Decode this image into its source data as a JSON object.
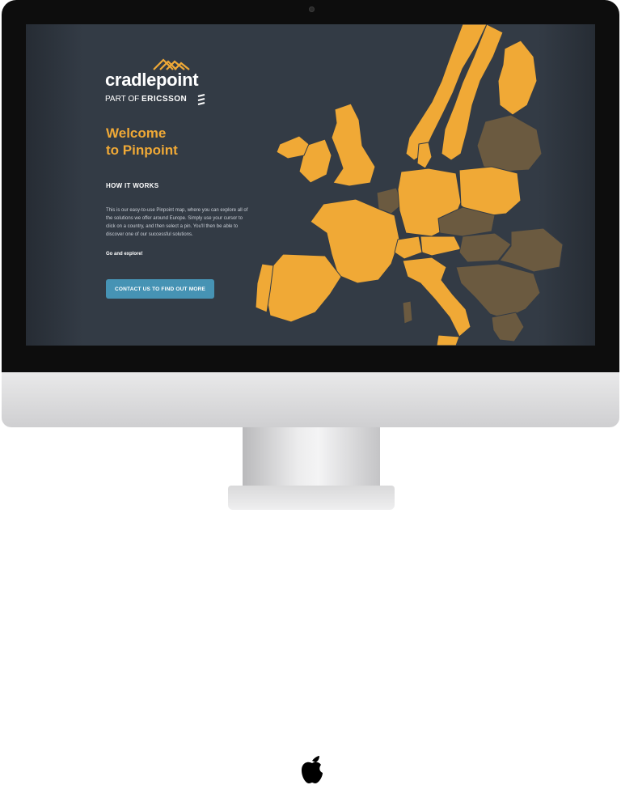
{
  "brand": {
    "name": "cradlepoint",
    "part_of_prefix": "PART OF",
    "part_of_company": "ERICSSON"
  },
  "hero": {
    "title_line1": "Welcome",
    "title_line2": "to Pinpoint"
  },
  "how_it_works": {
    "heading": "HOW IT WORKS",
    "description": "This is our easy-to-use Pinpoint map, where you can explore all of the solutions we offer around Europe. Simply use your cursor to click on a country, and then select a pin. You'll then be able to discover one of our successful solutions.",
    "cta_text": "Go and explore!"
  },
  "contact_button": {
    "label": "CONTACT US TO FIND OUT MORE"
  },
  "colors": {
    "screen_bg": "#333b45",
    "accent": "#f0a936",
    "active_country": "#f0a936",
    "inactive_country": "#6b5a40",
    "button": "#4693b4"
  },
  "map": {
    "icon": "europe-map",
    "highlighted_countries": [
      "Iceland-region",
      "Norway",
      "Sweden",
      "Finland",
      "United Kingdom",
      "Ireland",
      "France",
      "Spain",
      "Portugal",
      "Germany",
      "Poland",
      "Italy",
      "Switzerland",
      "Austria",
      "Denmark",
      "Netherlands"
    ],
    "inactive_countries": [
      "Baltics",
      "Belgium",
      "Czechia",
      "Hungary",
      "Balkans",
      "Romania",
      "Greece"
    ]
  }
}
